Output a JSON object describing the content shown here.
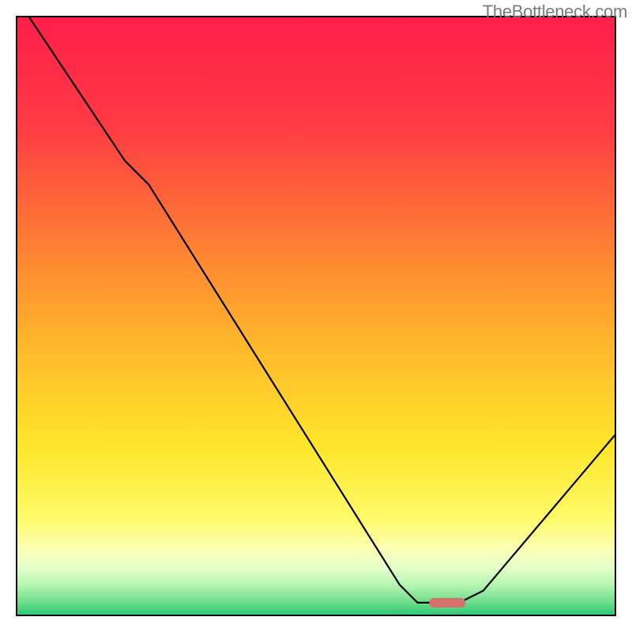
{
  "watermark": "TheBottleneck.com",
  "chart_data": {
    "type": "line",
    "title": "",
    "xlabel": "",
    "ylabel": "",
    "x_range": [
      0,
      100
    ],
    "y_range": [
      0,
      100
    ],
    "curve": [
      {
        "x": 2,
        "y": 100
      },
      {
        "x": 18,
        "y": 76
      },
      {
        "x": 22,
        "y": 72
      },
      {
        "x": 64,
        "y": 5
      },
      {
        "x": 67,
        "y": 2
      },
      {
        "x": 74,
        "y": 2
      },
      {
        "x": 78,
        "y": 4
      },
      {
        "x": 100,
        "y": 30
      }
    ],
    "bottom_marker": {
      "x": 72,
      "y": 2,
      "width_pct": 6
    },
    "gradient_stops": [
      {
        "offset": 0,
        "color": "#ff1f4a"
      },
      {
        "offset": 18,
        "color": "#ff3a44"
      },
      {
        "offset": 38,
        "color": "#ff7f33"
      },
      {
        "offset": 55,
        "color": "#ffb82b"
      },
      {
        "offset": 72,
        "color": "#ffe62b"
      },
      {
        "offset": 84,
        "color": "#fffb6a"
      },
      {
        "offset": 89,
        "color": "#fbffb4"
      },
      {
        "offset": 92,
        "color": "#e6ffc9"
      },
      {
        "offset": 95,
        "color": "#b6f6b2"
      },
      {
        "offset": 98,
        "color": "#6cdc8a"
      },
      {
        "offset": 100,
        "color": "#2fc877"
      }
    ]
  }
}
